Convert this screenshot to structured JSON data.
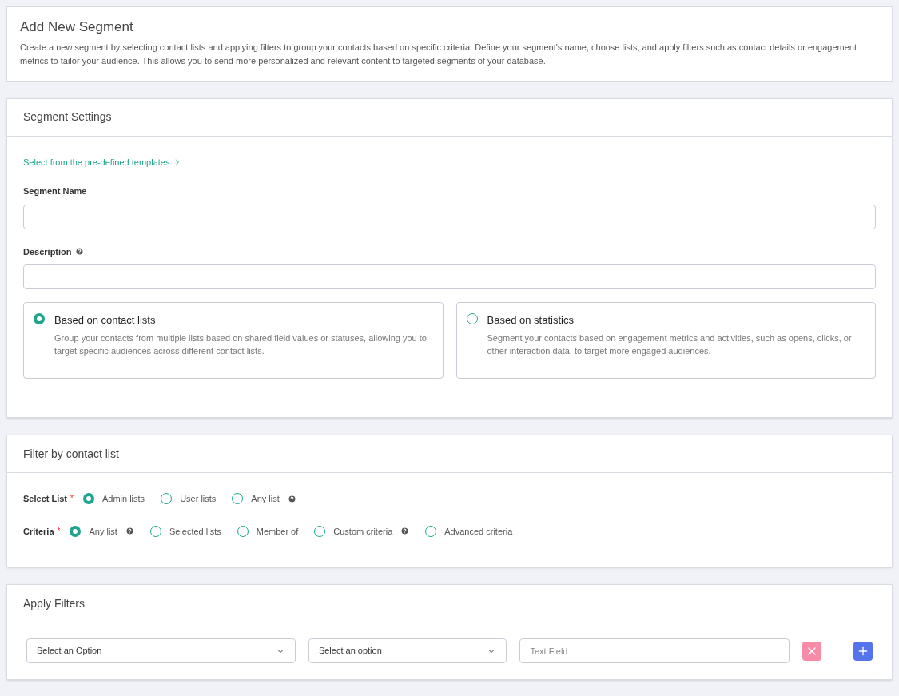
{
  "header": {
    "title": "Add New Segment",
    "description": "Create a new segment by selecting contact lists and applying filters to group your contacts based on specific criteria. Define your segment's name, choose lists, and apply filters such as contact details or engagement metrics to tailor your audience. This allows you to send more personalized and relevant content to targeted segments of your database."
  },
  "settings": {
    "title": "Segment Settings",
    "templates_link": "Select from the pre-defined templates",
    "fields": [
      {
        "label": "Segment Name",
        "help": false
      },
      {
        "label": "Description",
        "help": true
      }
    ],
    "types": [
      {
        "title": "Based on contact lists",
        "description": "Group your contacts from multiple lists based on shared field values or statuses, allowing you to target specific audiences across different contact lists.",
        "selected": true
      },
      {
        "title": "Based on statistics",
        "description": "Segment your contacts based on engagement metrics and activities, such as opens, clicks, or other interaction data, to target more engaged audiences.",
        "selected": false
      }
    ]
  },
  "contact_filter": {
    "title": "Filter by contact list",
    "groups": [
      {
        "label": "Select List",
        "required_mark": "*",
        "options": [
          {
            "label": "Admin lists",
            "selected": true,
            "help": false
          },
          {
            "label": "User lists",
            "selected": false,
            "help": false
          },
          {
            "label": "Any list",
            "selected": false,
            "help": true
          }
        ]
      },
      {
        "label": "Criteria",
        "required_mark": "*",
        "options": [
          {
            "label": "Any list",
            "selected": true,
            "help": true
          },
          {
            "label": "Selected lists",
            "selected": false,
            "help": false
          },
          {
            "label": "Member of",
            "selected": false,
            "help": false
          },
          {
            "label": "Custom criteria",
            "selected": false,
            "help": true
          },
          {
            "label": "Advanced criteria",
            "selected": false,
            "help": false
          }
        ]
      }
    ]
  },
  "apply_filters": {
    "title": "Apply Filters",
    "select_1": "Select an Option",
    "select_2": "Select an option",
    "text_field": {
      "placeholder": "Text Field"
    }
  }
}
